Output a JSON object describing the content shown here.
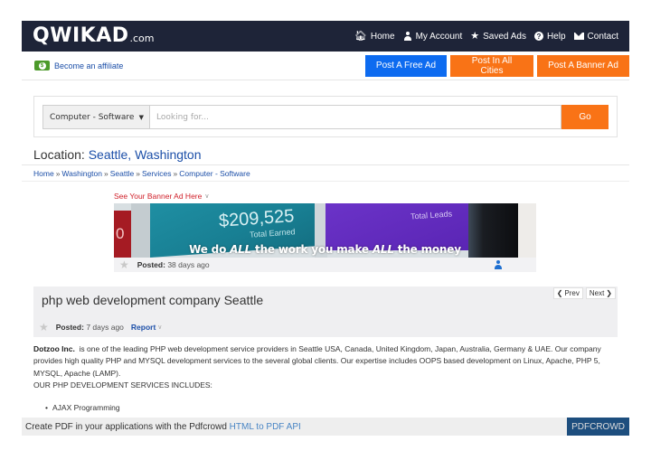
{
  "header": {
    "logo_main": "QWIKAD",
    "logo_tld": ".com",
    "nav": [
      {
        "icon": "home-icon",
        "label": "Home"
      },
      {
        "icon": "user-icon",
        "label": "My Account"
      },
      {
        "icon": "star-icon",
        "label": "Saved Ads"
      },
      {
        "icon": "question-circle-icon",
        "label": "Help"
      },
      {
        "icon": "envelope-icon",
        "label": "Contact"
      }
    ]
  },
  "subheader": {
    "affiliate_label": "Become an affiliate",
    "buttons": {
      "post_free": "Post A Free Ad",
      "post_all_cities": "Post In All Cities",
      "post_banner": "Post A Banner Ad"
    },
    "colors": {
      "blue": "#0d6bf0",
      "orange": "#f97316"
    }
  },
  "search": {
    "category_selected": "Computer - Software",
    "placeholder": "Looking for...",
    "go_label": "Go"
  },
  "location": {
    "prefix": "Location: ",
    "place": "Seattle, Washington"
  },
  "breadcrumb": [
    "Home",
    "Washington",
    "Seattle",
    "Services",
    "Computer - Software"
  ],
  "breadcrumb_sep": "»",
  "banner": {
    "label": "See Your Banner Ad Here",
    "image": {
      "amount": "$209,525",
      "earned": "Total Earned",
      "leads": "Total Leads",
      "left_digit": "0",
      "caption_parts": [
        "We do ",
        "ALL",
        " the work you make ",
        "ALL",
        " the money"
      ]
    },
    "posted_label": "Posted:",
    "posted_value": "38 days ago"
  },
  "ad": {
    "title": "php web development company Seattle",
    "prev_label": "Prev",
    "next_label": "Next",
    "posted_label": "Posted:",
    "posted_value": "7 days ago",
    "report_label": "Report",
    "company": "Dotzoo Inc.",
    "description": "  is one of the leading PHP web development service providers in Seattle USA, Canada, United Kingdom, Japan, Australia, Germany & UAE. Our company provides high quality PHP and MYSQL development services to the several global clients. Our expertise includes OOPS based development on Linux, Apache, PHP 5, MYSQL, Apache (LAMP).",
    "services_heading": "OUR PHP DEVELOPMENT SERVICES INCLUDES:",
    "services": [
      "AJAX Programming"
    ]
  },
  "pdfcrowd": {
    "text": "Create PDF in your applications with the Pdfcrowd ",
    "link": "HTML to PDF API",
    "button": "PDFCROWD"
  }
}
